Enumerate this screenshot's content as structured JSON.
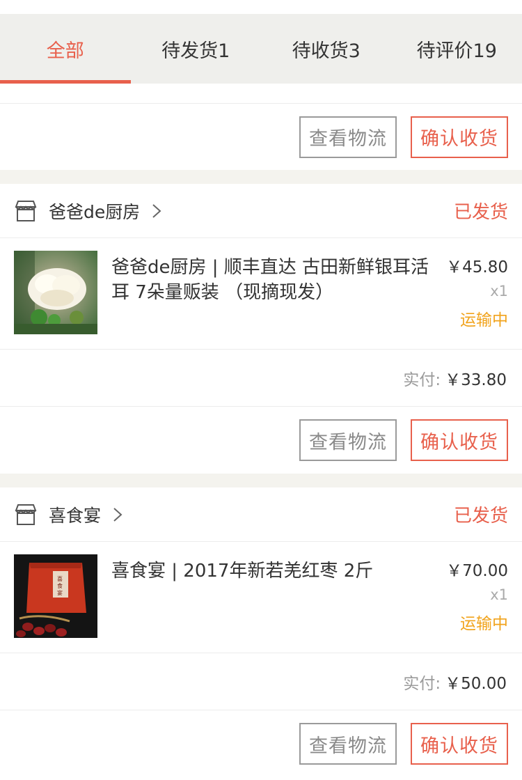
{
  "tabs": [
    {
      "label": "全部",
      "active": true
    },
    {
      "label": "待发货1",
      "active": false
    },
    {
      "label": "待收货3",
      "active": false
    },
    {
      "label": "待评价19",
      "active": false
    }
  ],
  "top_actions": {
    "logistics_label": "查看物流",
    "confirm_label": "确认收货"
  },
  "orders": [
    {
      "store_name": "爸爸de厨房",
      "status": "已发货",
      "item": {
        "title": "爸爸de厨房 | 顺丰直达 古田新鲜银耳活耳 7朵量贩装 （现摘现发）",
        "price": "￥45.80",
        "qty": "x1",
        "shipping": "运输中",
        "thumbnail": "white-fungus-photo"
      },
      "paid_label": "实付:",
      "paid_value": "￥33.80",
      "logistics_label": "查看物流",
      "confirm_label": "确认收货"
    },
    {
      "store_name": "喜食宴",
      "status": "已发货",
      "item": {
        "title": "喜食宴 | 2017年新若羌红枣 2斤",
        "price": "￥70.00",
        "qty": "x1",
        "shipping": "运输中",
        "thumbnail": "red-dates-photo"
      },
      "paid_label": "实付:",
      "paid_value": "￥50.00",
      "logistics_label": "查看物流",
      "confirm_label": "确认收货"
    }
  ],
  "colors": {
    "accent": "#e8604c",
    "transit": "#f1a31c",
    "tab_bg": "#efefec",
    "separator": "#f4f3ee"
  }
}
